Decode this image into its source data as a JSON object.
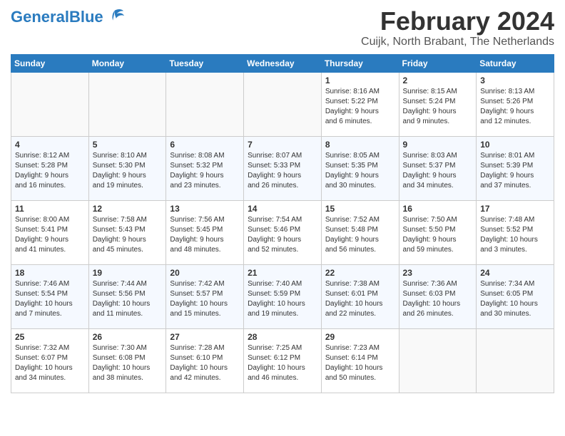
{
  "header": {
    "logo_text_general": "General",
    "logo_text_blue": "Blue",
    "month_title": "February 2024",
    "location": "Cuijk, North Brabant, The Netherlands"
  },
  "calendar": {
    "days_of_week": [
      "Sunday",
      "Monday",
      "Tuesday",
      "Wednesday",
      "Thursday",
      "Friday",
      "Saturday"
    ],
    "weeks": [
      [
        {
          "day": "",
          "info": ""
        },
        {
          "day": "",
          "info": ""
        },
        {
          "day": "",
          "info": ""
        },
        {
          "day": "",
          "info": ""
        },
        {
          "day": "1",
          "info": "Sunrise: 8:16 AM\nSunset: 5:22 PM\nDaylight: 9 hours\nand 6 minutes."
        },
        {
          "day": "2",
          "info": "Sunrise: 8:15 AM\nSunset: 5:24 PM\nDaylight: 9 hours\nand 9 minutes."
        },
        {
          "day": "3",
          "info": "Sunrise: 8:13 AM\nSunset: 5:26 PM\nDaylight: 9 hours\nand 12 minutes."
        }
      ],
      [
        {
          "day": "4",
          "info": "Sunrise: 8:12 AM\nSunset: 5:28 PM\nDaylight: 9 hours\nand 16 minutes."
        },
        {
          "day": "5",
          "info": "Sunrise: 8:10 AM\nSunset: 5:30 PM\nDaylight: 9 hours\nand 19 minutes."
        },
        {
          "day": "6",
          "info": "Sunrise: 8:08 AM\nSunset: 5:32 PM\nDaylight: 9 hours\nand 23 minutes."
        },
        {
          "day": "7",
          "info": "Sunrise: 8:07 AM\nSunset: 5:33 PM\nDaylight: 9 hours\nand 26 minutes."
        },
        {
          "day": "8",
          "info": "Sunrise: 8:05 AM\nSunset: 5:35 PM\nDaylight: 9 hours\nand 30 minutes."
        },
        {
          "day": "9",
          "info": "Sunrise: 8:03 AM\nSunset: 5:37 PM\nDaylight: 9 hours\nand 34 minutes."
        },
        {
          "day": "10",
          "info": "Sunrise: 8:01 AM\nSunset: 5:39 PM\nDaylight: 9 hours\nand 37 minutes."
        }
      ],
      [
        {
          "day": "11",
          "info": "Sunrise: 8:00 AM\nSunset: 5:41 PM\nDaylight: 9 hours\nand 41 minutes."
        },
        {
          "day": "12",
          "info": "Sunrise: 7:58 AM\nSunset: 5:43 PM\nDaylight: 9 hours\nand 45 minutes."
        },
        {
          "day": "13",
          "info": "Sunrise: 7:56 AM\nSunset: 5:45 PM\nDaylight: 9 hours\nand 48 minutes."
        },
        {
          "day": "14",
          "info": "Sunrise: 7:54 AM\nSunset: 5:46 PM\nDaylight: 9 hours\nand 52 minutes."
        },
        {
          "day": "15",
          "info": "Sunrise: 7:52 AM\nSunset: 5:48 PM\nDaylight: 9 hours\nand 56 minutes."
        },
        {
          "day": "16",
          "info": "Sunrise: 7:50 AM\nSunset: 5:50 PM\nDaylight: 9 hours\nand 59 minutes."
        },
        {
          "day": "17",
          "info": "Sunrise: 7:48 AM\nSunset: 5:52 PM\nDaylight: 10 hours\nand 3 minutes."
        }
      ],
      [
        {
          "day": "18",
          "info": "Sunrise: 7:46 AM\nSunset: 5:54 PM\nDaylight: 10 hours\nand 7 minutes."
        },
        {
          "day": "19",
          "info": "Sunrise: 7:44 AM\nSunset: 5:56 PM\nDaylight: 10 hours\nand 11 minutes."
        },
        {
          "day": "20",
          "info": "Sunrise: 7:42 AM\nSunset: 5:57 PM\nDaylight: 10 hours\nand 15 minutes."
        },
        {
          "day": "21",
          "info": "Sunrise: 7:40 AM\nSunset: 5:59 PM\nDaylight: 10 hours\nand 19 minutes."
        },
        {
          "day": "22",
          "info": "Sunrise: 7:38 AM\nSunset: 6:01 PM\nDaylight: 10 hours\nand 22 minutes."
        },
        {
          "day": "23",
          "info": "Sunrise: 7:36 AM\nSunset: 6:03 PM\nDaylight: 10 hours\nand 26 minutes."
        },
        {
          "day": "24",
          "info": "Sunrise: 7:34 AM\nSunset: 6:05 PM\nDaylight: 10 hours\nand 30 minutes."
        }
      ],
      [
        {
          "day": "25",
          "info": "Sunrise: 7:32 AM\nSunset: 6:07 PM\nDaylight: 10 hours\nand 34 minutes."
        },
        {
          "day": "26",
          "info": "Sunrise: 7:30 AM\nSunset: 6:08 PM\nDaylight: 10 hours\nand 38 minutes."
        },
        {
          "day": "27",
          "info": "Sunrise: 7:28 AM\nSunset: 6:10 PM\nDaylight: 10 hours\nand 42 minutes."
        },
        {
          "day": "28",
          "info": "Sunrise: 7:25 AM\nSunset: 6:12 PM\nDaylight: 10 hours\nand 46 minutes."
        },
        {
          "day": "29",
          "info": "Sunrise: 7:23 AM\nSunset: 6:14 PM\nDaylight: 10 hours\nand 50 minutes."
        },
        {
          "day": "",
          "info": ""
        },
        {
          "day": "",
          "info": ""
        }
      ]
    ]
  }
}
